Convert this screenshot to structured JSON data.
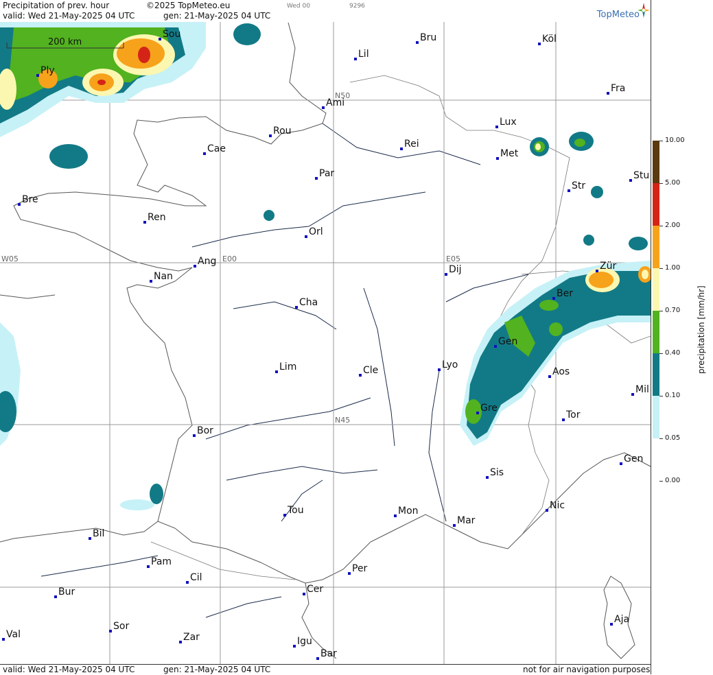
{
  "header": {
    "title": "Precipitation of prev. hour",
    "copyright": "©2025 TopMeteo.eu",
    "valid": "valid:  Wed  21-May-2025  04 UTC",
    "gen": "gen: 21-May-2025 04 UTC",
    "small1": "Wed 00",
    "small2": "9296",
    "brand": "TopMeteo"
  },
  "scale_bar": "200 km",
  "grid_labels": {
    "n50": "N50",
    "n45": "N45",
    "w05": "W05",
    "e00": "E00",
    "e05": "E05"
  },
  "cities": [
    {
      "name": "Sou"
    },
    {
      "name": "Ply"
    },
    {
      "name": "Bru"
    },
    {
      "name": "Köl"
    },
    {
      "name": "Lil"
    },
    {
      "name": "Fra"
    },
    {
      "name": "Ami"
    },
    {
      "name": "Lux"
    },
    {
      "name": "Rou"
    },
    {
      "name": "Cae"
    },
    {
      "name": "Rei"
    },
    {
      "name": "Met"
    },
    {
      "name": "Par"
    },
    {
      "name": "Str"
    },
    {
      "name": "Stu"
    },
    {
      "name": "Bre"
    },
    {
      "name": "Ren"
    },
    {
      "name": "Orl"
    },
    {
      "name": "Ang"
    },
    {
      "name": "Nan"
    },
    {
      "name": "Dij"
    },
    {
      "name": "Zür"
    },
    {
      "name": "Ber"
    },
    {
      "name": "Cha"
    },
    {
      "name": "Gen"
    },
    {
      "name": "Lim"
    },
    {
      "name": "Cle"
    },
    {
      "name": "Lyo"
    },
    {
      "name": "Aos"
    },
    {
      "name": "Mil"
    },
    {
      "name": "Gre"
    },
    {
      "name": "Tor"
    },
    {
      "name": "Bor"
    },
    {
      "name": "Gen"
    },
    {
      "name": "Sis"
    },
    {
      "name": "Nic"
    },
    {
      "name": "Tou"
    },
    {
      "name": "Mon"
    },
    {
      "name": "Mar"
    },
    {
      "name": "Bil"
    },
    {
      "name": "Pam"
    },
    {
      "name": "Cil"
    },
    {
      "name": "Per"
    },
    {
      "name": "Bur"
    },
    {
      "name": "Cer"
    },
    {
      "name": "Aja"
    },
    {
      "name": "Val"
    },
    {
      "name": "Sor"
    },
    {
      "name": "Zar"
    },
    {
      "name": "Igu"
    },
    {
      "name": "Bar"
    }
  ],
  "footer": {
    "valid": "valid:  Wed  21-May-2025  04 UTC",
    "gen": "gen: 21-May-2025 04 UTC",
    "notice": "not for air navigation purposes"
  },
  "legend": {
    "unit": "precipitation [mm/hr]",
    "levels": [
      {
        "label": "10.00",
        "color": "#5a3a10"
      },
      {
        "label": "5.00",
        "color": "#d42418"
      },
      {
        "label": "2.00",
        "color": "#f7a21b"
      },
      {
        "label": "1.00",
        "color": "#fbf7b0"
      },
      {
        "label": "0.70",
        "color": "#52b21f"
      },
      {
        "label": "0.40",
        "color": "#127a86"
      },
      {
        "label": "0.10",
        "color": "#c6f1f7"
      },
      {
        "label": "0.05",
        "color": "#ffffff"
      },
      {
        "label": "0.00",
        "color": "#ffffff"
      }
    ]
  }
}
